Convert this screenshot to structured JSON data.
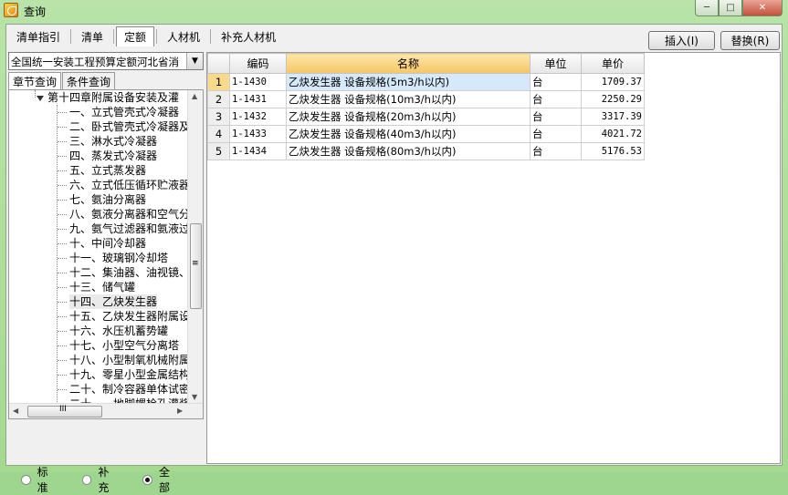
{
  "window": {
    "title": "查询",
    "min_label": "─",
    "max_label": "□",
    "close_label": "✕"
  },
  "tabs": [
    "清单指引",
    "清单",
    "定额",
    "人材机",
    "补充人材机"
  ],
  "active_tab": 2,
  "buttons": {
    "insert": "插入(I)",
    "replace": "替换(R)"
  },
  "library_select": "全国统一安装工程预算定额河北省消",
  "subtabs": {
    "chapter": "章节查询",
    "condition": "条件查询"
  },
  "tree": {
    "parent": "第十四章附属设备安装及灌",
    "children": [
      "一、立式管壳式冷凝器",
      "二、卧式管壳式冷凝器及",
      "三、淋水式冷凝器",
      "四、蒸发式冷凝器",
      "五、立式蒸发器",
      "六、立式低压循环贮液器",
      "七、氨油分离器",
      "八、氨液分离器和空气分",
      "九、氨气过滤器和氨液过",
      "十、中间冷却器",
      "十一、玻璃钢冷却塔",
      "十二、集油器、油视镜、",
      "十三、储气罐",
      "十四、乙炔发生器",
      "十五、乙炔发生器附属设",
      "十六、水压机蓄势罐",
      "十七、小型空气分离塔",
      "十八、小型制氧机械附属",
      "十九、零星小型金属结构",
      "二十、制冷容器单体试密",
      "二十一、地脚螺栓孔灌浆"
    ],
    "selected_index": 13
  },
  "scroll_grip": "≡",
  "hscroll_grip": "III",
  "radios": {
    "options": [
      "标准",
      "补充",
      "全部"
    ],
    "selected": 2
  },
  "table": {
    "headers": {
      "code": "编码",
      "name": "名称",
      "unit": "单位",
      "price": "单价"
    },
    "rows": [
      {
        "no": "1",
        "code": "1-1430",
        "name": "乙炔发生器 设备规格(5m3/h以内)",
        "unit": "台",
        "price": "1709.37"
      },
      {
        "no": "2",
        "code": "1-1431",
        "name": "乙炔发生器 设备规格(10m3/h以内)",
        "unit": "台",
        "price": "2250.29"
      },
      {
        "no": "3",
        "code": "1-1432",
        "name": "乙炔发生器 设备规格(20m3/h以内)",
        "unit": "台",
        "price": "3317.39"
      },
      {
        "no": "4",
        "code": "1-1433",
        "name": "乙炔发生器 设备规格(40m3/h以内)",
        "unit": "台",
        "price": "4021.72"
      },
      {
        "no": "5",
        "code": "1-1434",
        "name": "乙炔发生器 设备规格(80m3/h以内)",
        "unit": "台",
        "price": "5176.53"
      }
    ],
    "selected_row": 0
  }
}
